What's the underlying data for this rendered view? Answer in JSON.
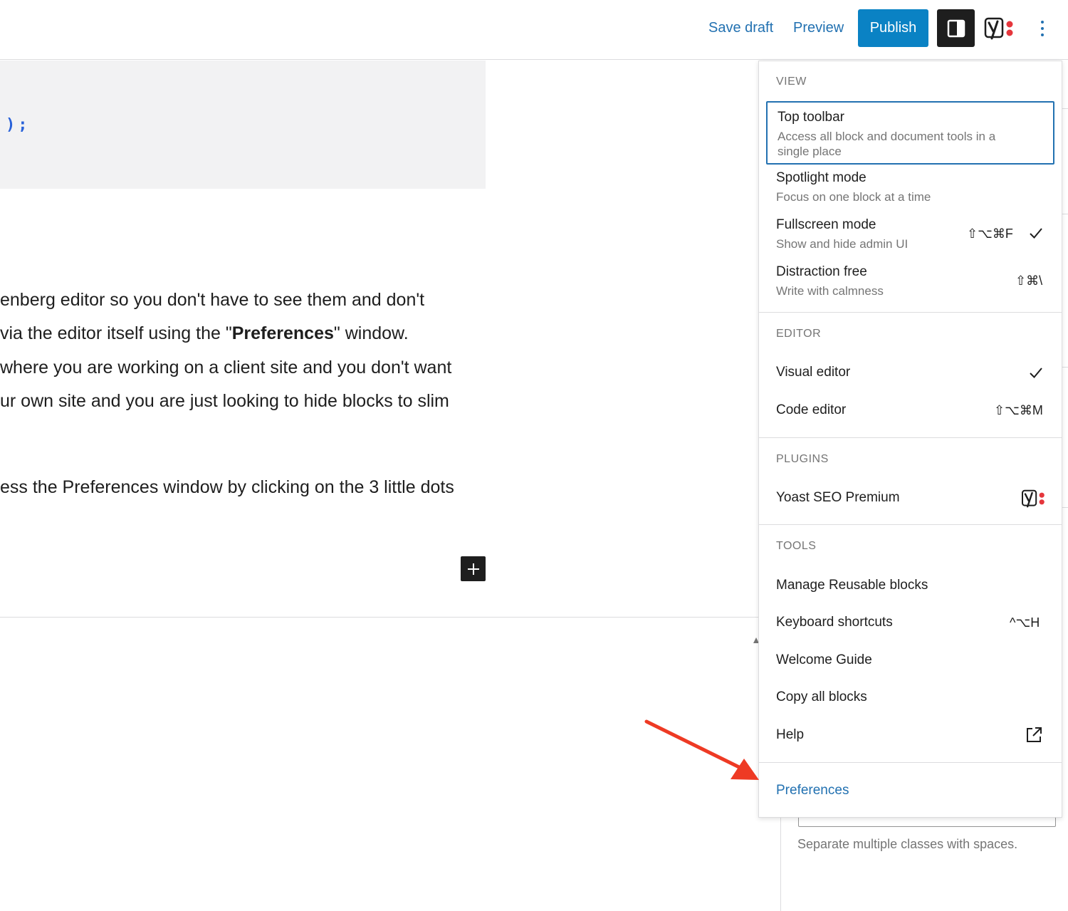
{
  "header": {
    "save_draft": "Save draft",
    "preview": "Preview",
    "publish": "Publish",
    "icons": [
      "sidebar-toggle-icon",
      "yoast-icon",
      "more-options-icon"
    ]
  },
  "editor": {
    "code_line": ");",
    "paragraph_lines": [
      "enberg editor so you don't have to see them and don't",
      "where you are working on a client site and you don't want",
      "ur own site and you are just looking to hide blocks to slim"
    ],
    "preferences_line": {
      "before": "via the editor itself using the \"",
      "bold": "Preferences",
      "after": "\" window."
    },
    "paragraph2": "ess the Preferences window by clicking on the 3 little dots"
  },
  "sidebar": {
    "class_help": "Separate multiple classes with spaces."
  },
  "menu": {
    "view": {
      "title": "VIEW",
      "top_toolbar": {
        "label": "Top toolbar",
        "desc": "Access all block and document tools in a single place"
      },
      "spotlight": {
        "label": "Spotlight mode",
        "desc": "Focus on one block at a time"
      },
      "fullscreen": {
        "label": "Fullscreen mode",
        "desc": "Show and hide admin UI",
        "shortcut": "⇧⌥⌘F",
        "checked": true
      },
      "distraction": {
        "label": "Distraction free",
        "desc": "Write with calmness",
        "shortcut": "⇧⌘\\"
      }
    },
    "editor": {
      "title": "EDITOR",
      "visual": {
        "label": "Visual editor",
        "checked": true
      },
      "code": {
        "label": "Code editor",
        "shortcut": "⇧⌥⌘M"
      }
    },
    "plugins": {
      "title": "PLUGINS",
      "yoast": {
        "label": "Yoast SEO Premium"
      }
    },
    "tools": {
      "title": "TOOLS",
      "reusable": {
        "label": "Manage Reusable blocks"
      },
      "shortcuts": {
        "label": "Keyboard shortcuts",
        "shortcut": "^⌥H"
      },
      "welcome": {
        "label": "Welcome Guide"
      },
      "copy": {
        "label": "Copy all blocks"
      },
      "help": {
        "label": "Help"
      }
    },
    "preferences": {
      "label": "Preferences"
    }
  },
  "colors": {
    "accent": "#2271b1",
    "publish": "#0a82c4",
    "annotation_arrow": "#ee3a24",
    "yoast_red": "#e5363c"
  }
}
